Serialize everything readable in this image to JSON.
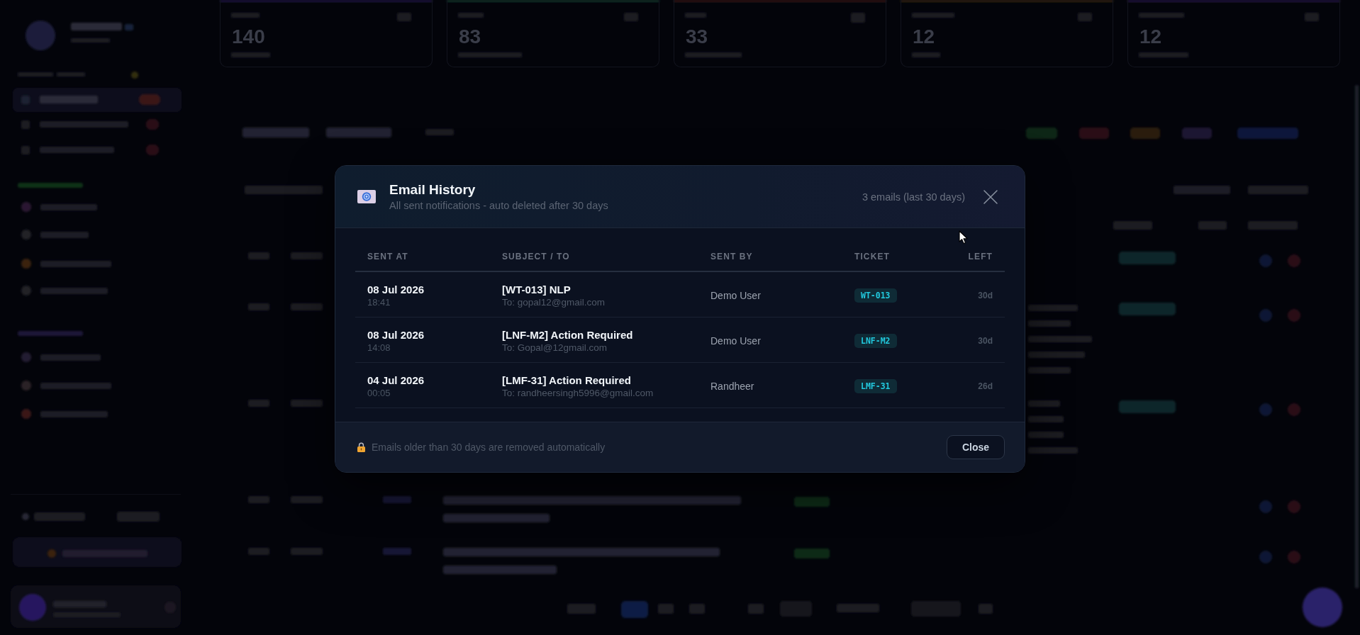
{
  "dashboard": {
    "stat_cards": [
      {
        "value": "140"
      },
      {
        "value": "83"
      },
      {
        "value": "33"
      },
      {
        "value": "12"
      },
      {
        "value": "12"
      }
    ]
  },
  "dialog": {
    "title": "Email History",
    "subtitle": "All sent notifications - auto deleted after 30 days",
    "count": "3 emails (last 30 days)",
    "table": {
      "columns": [
        "SENT AT",
        "SUBJECT / TO",
        "SENT BY",
        "TICKET",
        "LEFT"
      ],
      "rows": [
        {
          "date": "08 Jul 2026",
          "time": "18:41",
          "subject": "[WT-013] NLP",
          "to": "To: gopal12@gmail.com",
          "sent_by": "Demo User",
          "ticket": "WT-013",
          "left": "30d"
        },
        {
          "date": "08 Jul 2026",
          "time": "14:08",
          "subject": "[LNF-M2] Action Required",
          "to": "To: Gopal@12gmail.com",
          "sent_by": "Demo User",
          "ticket": "LNF-M2",
          "left": "30d"
        },
        {
          "date": "04 Jul 2026",
          "time": "00:05",
          "subject": "[LMF-31] Action Required",
          "to": "To: randheersingh5996@gmail.com",
          "sent_by": "Randheer",
          "ticket": "LMF-31",
          "left": "26d"
        }
      ]
    },
    "footer": {
      "note": "Emails older than 30 days are removed automatically",
      "close_button": "Close"
    }
  }
}
